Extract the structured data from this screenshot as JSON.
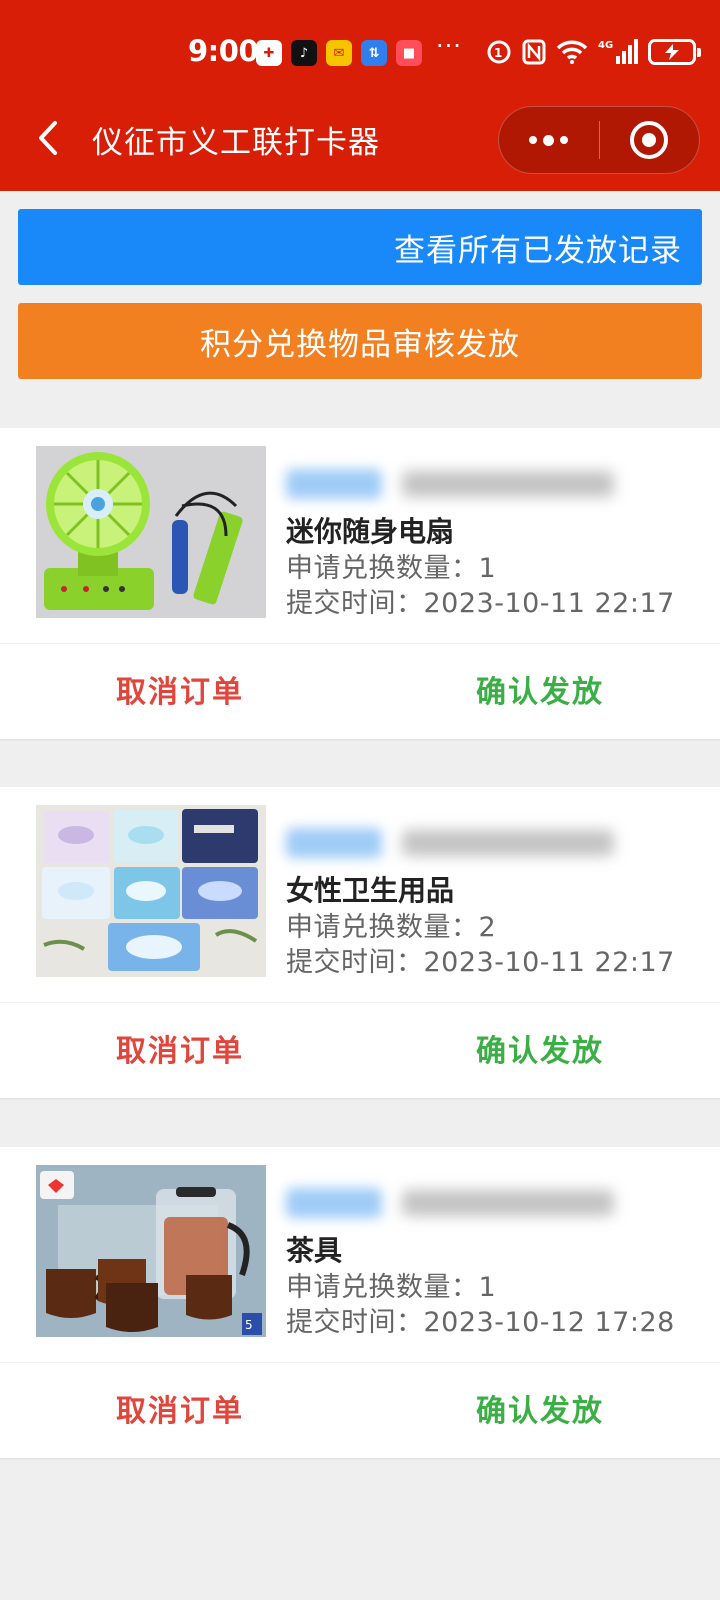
{
  "status_bar": {
    "time": "9:00",
    "more": "···",
    "network": "4G"
  },
  "nav": {
    "title": "仪征市义工联打卡器"
  },
  "actions": {
    "records_label": "查看所有已发放记录",
    "audit_label": "积分兑换物品审核发放"
  },
  "orders": [
    {
      "item_name": "迷你随身电扇",
      "quantity_text": "申请兑换数量：1",
      "time_text": "提交时间：2023-10-11 22:17",
      "image_icon": "mini-fan",
      "cancel_label": "取消订单",
      "confirm_label": "确认发放"
    },
    {
      "item_name": "女性卫生用品",
      "quantity_text": "申请兑换数量：2",
      "time_text": "提交时间：2023-10-11 22:17",
      "image_icon": "sanitary-pads",
      "cancel_label": "取消订单",
      "confirm_label": "确认发放"
    },
    {
      "item_name": "茶具",
      "quantity_text": "申请兑换数量：1",
      "time_text": "提交时间：2023-10-12 17:28",
      "image_icon": "tea-set",
      "cancel_label": "取消订单",
      "confirm_label": "确认发放"
    }
  ],
  "colors": {
    "header": "#d81e06",
    "records_button": "#1989fa",
    "audit_button": "#f28021",
    "cancel": "#e0463b",
    "confirm": "#3cae46"
  }
}
